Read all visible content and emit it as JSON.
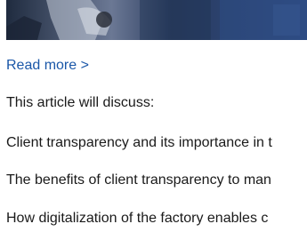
{
  "article": {
    "read_more_label": "Read more >",
    "intro_text": "This article will discuss:",
    "topics": [
      "Client transparency and its importance in t",
      "The benefits of client transparency to man",
      "How digitalization of the factory enables c"
    ]
  },
  "colors": {
    "link": "#1a57a8",
    "body_text": "#1a1a1a",
    "hero_dark": "#2c3a52",
    "hero_blue": "#2f4c80"
  }
}
